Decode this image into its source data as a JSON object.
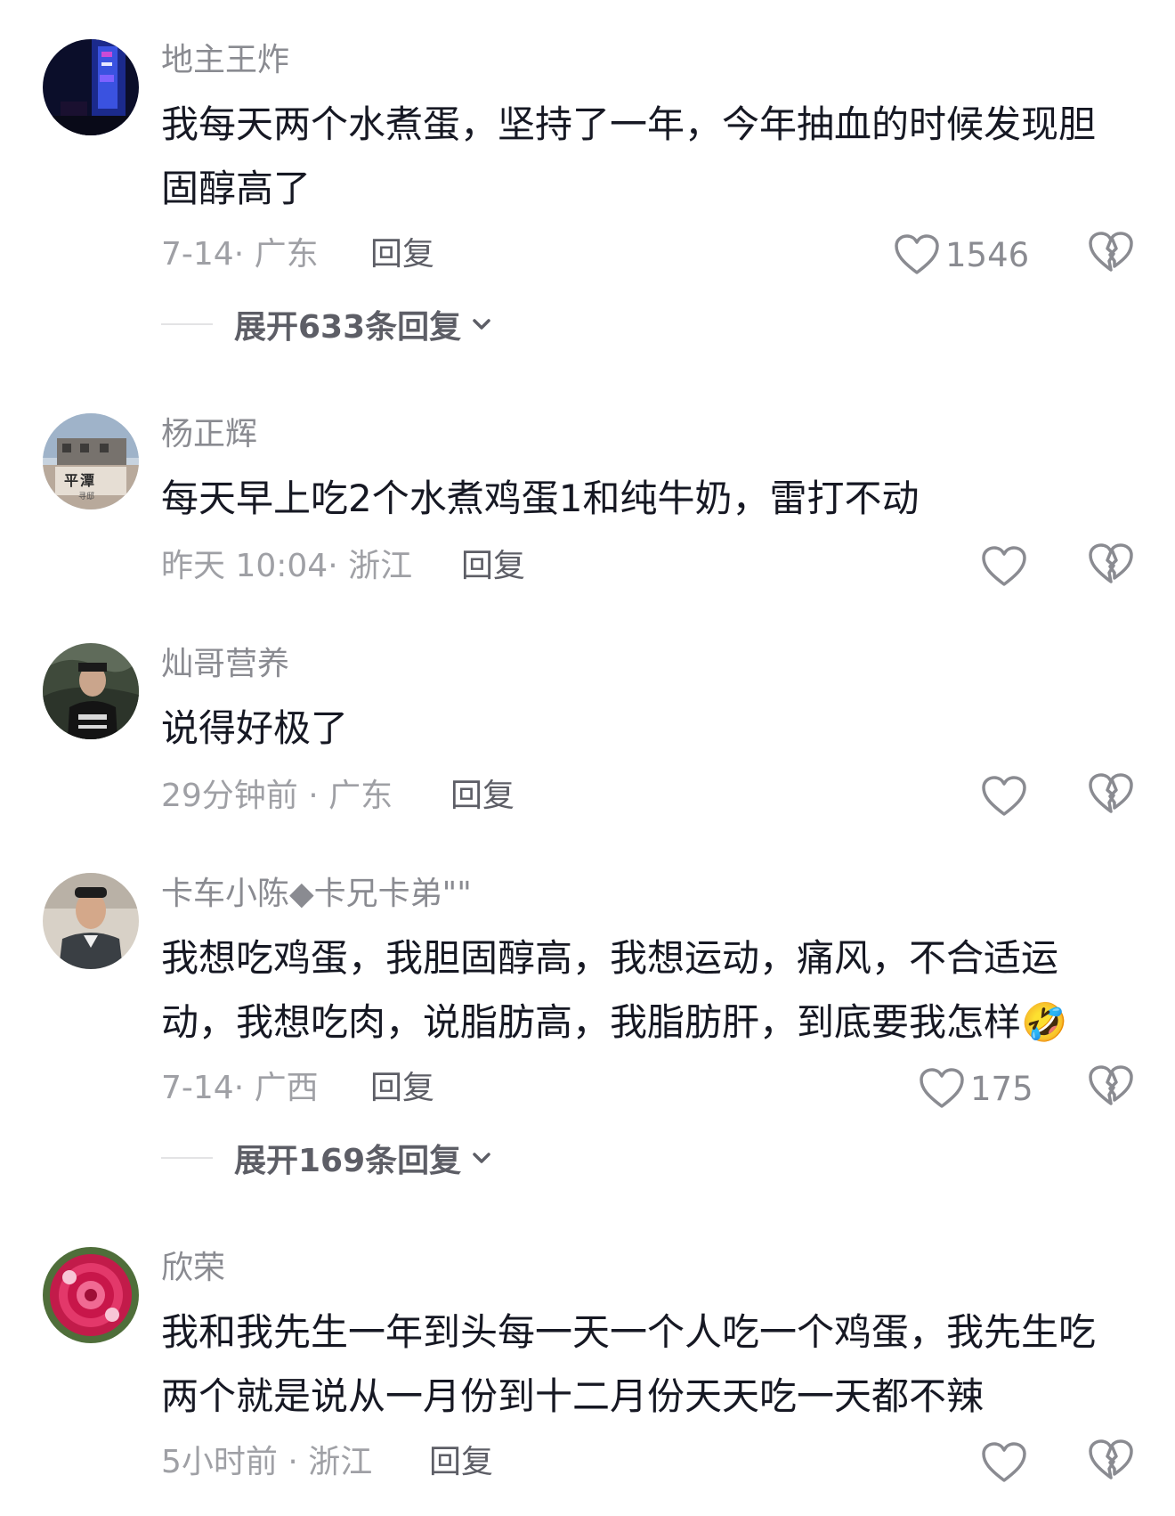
{
  "comments": [
    {
      "username": "地主王炸",
      "text": "我每天两个水煮蛋，坚持了一年，今年抽血的时候发现胆固醇高了",
      "meta": "7-14· 广东",
      "reply_label": "回复",
      "likes": "1546",
      "expand_label": "展开633条回复"
    },
    {
      "username": "杨正辉",
      "text": "每天早上吃2个水煮鸡蛋1和纯牛奶，雷打不动",
      "meta": "昨天 10:04· 浙江",
      "reply_label": "回复",
      "avatar_sign": "平潭",
      "avatar_sub": "寻邸"
    },
    {
      "username": "灿哥营养",
      "text": "说得好极了",
      "meta": "29分钟前 · 广东",
      "reply_label": "回复"
    },
    {
      "username": "卡车小陈◆卡兄卡弟\"\"",
      "text": "我想吃鸡蛋，我胆固醇高，我想运动，痛风，不合适运动，我想吃肉，说脂肪高，我脂肪肝，到底要我怎样🤣",
      "meta": "7-14· 广西",
      "reply_label": "回复",
      "likes": "175",
      "expand_label": "展开169条回复"
    },
    {
      "username": "欣荣",
      "text": "我和我先生一年到头每一天一个人吃一个鸡蛋，我先生吃两个就是说从一月份到十二月份天天吃一天都不辣",
      "meta": "5小时前 · 浙江",
      "reply_label": "回复"
    }
  ],
  "icons": {
    "like": "heart-outline-icon",
    "dislike": "broken-heart-icon",
    "expand": "chevron-down-icon"
  },
  "colors": {
    "username": "#8a8b91",
    "text": "#161823",
    "meta": "#9fa0a5",
    "action": "#5d5e66"
  }
}
